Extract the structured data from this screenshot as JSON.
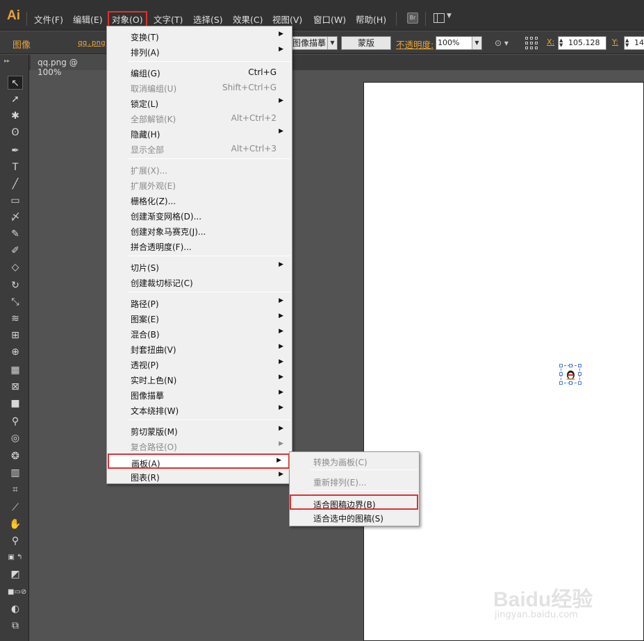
{
  "app": {
    "logo": "Ai"
  },
  "menubar": {
    "items": [
      "文件(F)",
      "编辑(E)",
      "对象(O)",
      "文字(T)",
      "选择(S)",
      "效果(C)",
      "视图(V)",
      "窗口(W)",
      "帮助(H)"
    ],
    "bridge_label": "Br"
  },
  "controlbar": {
    "image_label": "图像",
    "file_link": "qq.png",
    "trace_label": "图像描摹",
    "mask_label": "蒙版",
    "opacity_label": "不透明度:",
    "opacity_value": "100%",
    "x_label": "X:",
    "x_value": "105.128",
    "y_label": "Y:",
    "y_value": "14"
  },
  "document": {
    "tab_title": "qq.png @ 100%"
  },
  "object_menu": {
    "groups": [
      [
        {
          "label": "变换(T)",
          "submenu": true
        },
        {
          "label": "排列(A)",
          "submenu": true
        }
      ],
      [
        {
          "label": "编组(G)",
          "shortcut": "Ctrl+G"
        },
        {
          "label": "取消编组(U)",
          "shortcut": "Shift+Ctrl+G",
          "disabled": true
        },
        {
          "label": "锁定(L)",
          "submenu": true
        },
        {
          "label": "全部解锁(K)",
          "shortcut": "Alt+Ctrl+2",
          "disabled": true
        },
        {
          "label": "隐藏(H)",
          "submenu": true
        },
        {
          "label": "显示全部",
          "shortcut": "Alt+Ctrl+3",
          "disabled": true
        }
      ],
      [
        {
          "label": "扩展(X)...",
          "disabled": true
        },
        {
          "label": "扩展外观(E)",
          "disabled": true
        },
        {
          "label": "栅格化(Z)..."
        },
        {
          "label": "创建渐变网格(D)..."
        },
        {
          "label": "创建对象马赛克(J)..."
        },
        {
          "label": "拼合透明度(F)..."
        }
      ],
      [
        {
          "label": "切片(S)",
          "submenu": true
        },
        {
          "label": "创建裁切标记(C)"
        }
      ],
      [
        {
          "label": "路径(P)",
          "submenu": true
        },
        {
          "label": "图案(E)",
          "submenu": true
        },
        {
          "label": "混合(B)",
          "submenu": true
        },
        {
          "label": "封套扭曲(V)",
          "submenu": true
        },
        {
          "label": "透视(P)",
          "submenu": true
        },
        {
          "label": "实时上色(N)",
          "submenu": true
        },
        {
          "label": "图像描摹",
          "submenu": true
        },
        {
          "label": "文本绕排(W)",
          "submenu": true
        }
      ],
      [
        {
          "label": "剪切蒙版(M)",
          "submenu": true
        },
        {
          "label": "复合路径(O)",
          "submenu": true,
          "disabled": true
        },
        {
          "label": "画板(A)",
          "submenu": true,
          "highlighted": true
        },
        {
          "label": "图表(R)",
          "submenu": true
        }
      ]
    ]
  },
  "artboard_submenu": {
    "items": [
      {
        "label": "转换为画板(C)",
        "disabled": true
      },
      {
        "label": "重新排列(E)...",
        "disabled": true
      },
      {
        "label": "适合图稿边界(B)",
        "highlighted": true
      },
      {
        "label": "适合选中的图稿(S)"
      }
    ]
  },
  "watermark": {
    "text": "Baidu经验",
    "url": "jingyan.baidu.com"
  },
  "colors": {
    "accent": "#e8a33c",
    "highlight_border": "#e03030",
    "menu_bg": "#f0f0f0",
    "ui_dark": "#323232"
  }
}
